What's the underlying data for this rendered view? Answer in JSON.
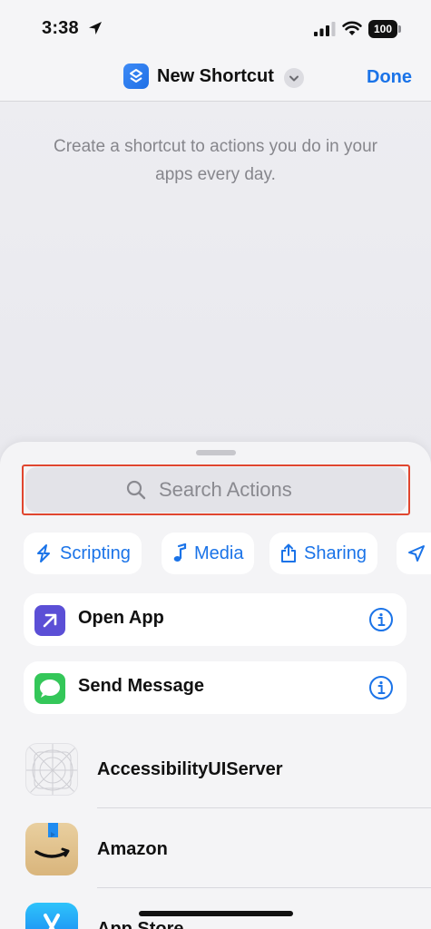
{
  "status_bar": {
    "time": "3:38",
    "battery": "100"
  },
  "nav": {
    "title": "New Shortcut",
    "done_label": "Done"
  },
  "hint": "Create a shortcut to actions you do in your apps every day.",
  "search": {
    "placeholder": "Search Actions"
  },
  "categories": [
    {
      "label": "Scripting",
      "icon": "scripting-icon"
    },
    {
      "label": "Media",
      "icon": "music-note-icon"
    },
    {
      "label": "Sharing",
      "icon": "share-icon"
    },
    {
      "label": "",
      "icon": "location-arrow-icon"
    }
  ],
  "suggested_actions": [
    {
      "label": "Open App",
      "icon": "open-app-icon",
      "color": "#5b4fd6"
    },
    {
      "label": "Send Message",
      "icon": "messages-icon",
      "color": "#34c759"
    }
  ],
  "apps": [
    {
      "label": "AccessibilityUIServer",
      "icon": "accessibility-ui-server-icon"
    },
    {
      "label": "Amazon",
      "icon": "amazon-icon"
    },
    {
      "label": "App Store",
      "icon": "app-store-icon"
    }
  ],
  "colors": {
    "accent": "#1a73e8",
    "highlight_outline": "#e0462f"
  }
}
